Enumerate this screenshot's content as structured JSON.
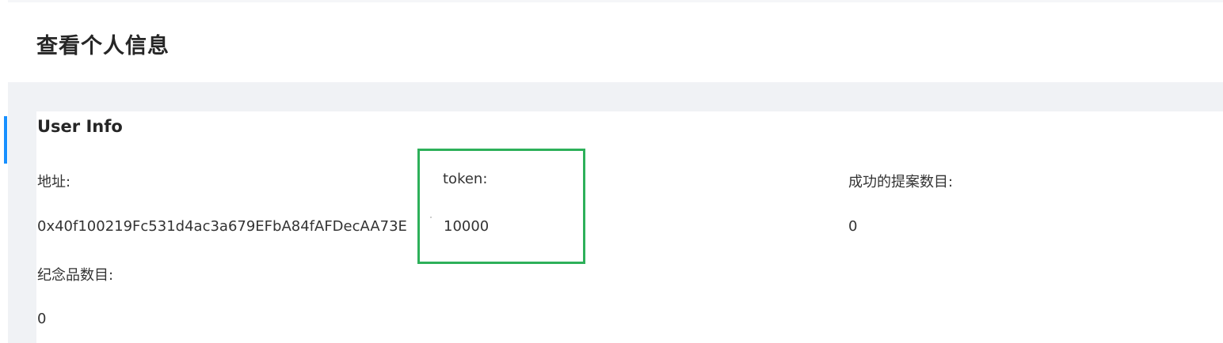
{
  "page": {
    "title": "查看个人信息"
  },
  "card": {
    "title": "User Info",
    "fields": [
      {
        "label": "地址:",
        "value": "0x40f100219Fc531d4ac3a679EFbA84fAFDecAA73E"
      },
      {
        "label": "token:",
        "value": "10000"
      },
      {
        "label": "成功的提案数目:",
        "value": "0"
      },
      {
        "label": "纪念品数目:",
        "value": "0"
      }
    ]
  },
  "colors": {
    "accent": "#1890ff",
    "highlight": "#2db05a",
    "background": "#f0f2f5"
  }
}
